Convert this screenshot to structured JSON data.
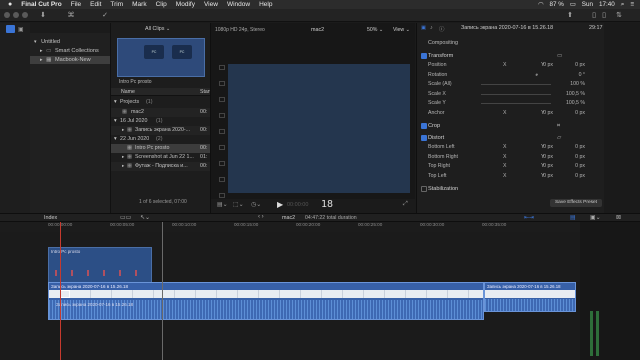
{
  "menubar": {
    "apple": "",
    "items": [
      "Final Cut Pro",
      "File",
      "Edit",
      "Trim",
      "Mark",
      "Clip",
      "Modify",
      "View",
      "Window",
      "Help"
    ],
    "battery": "87 %",
    "day": "Sun",
    "time": "17:40"
  },
  "toolbar": {
    "icons": [
      "import-icon",
      "keywords-icon",
      "checkmark-icon"
    ]
  },
  "sidebar": {
    "items": [
      {
        "label": "Untitled",
        "level": 0
      },
      {
        "label": "Smart Collections",
        "level": 1
      },
      {
        "label": "Macbook-New",
        "level": 1,
        "selected": true
      }
    ]
  },
  "browser": {
    "filter_label": "All Clips",
    "filmstrip_caption": "Intro Pc prosto",
    "columns": [
      "Name",
      "Start"
    ],
    "rows": [
      {
        "name": "Projects",
        "count": "(1)",
        "start": "",
        "type": "group"
      },
      {
        "name": "mac2",
        "count": "",
        "start": "00:",
        "type": "item"
      },
      {
        "name": "16 Jul 2020",
        "count": "(1)",
        "start": "",
        "type": "group"
      },
      {
        "name": "Запись экрана 2020-...",
        "count": "",
        "start": "00:",
        "type": "item"
      },
      {
        "name": "22 Jun 2020",
        "count": "(2)",
        "start": "",
        "type": "group"
      },
      {
        "name": "Intro Pc prosto",
        "count": "",
        "start": "00:",
        "type": "item",
        "selected": true
      },
      {
        "name": "Screenshot at Jun 22 1...",
        "count": "",
        "start": "01:",
        "type": "item"
      },
      {
        "name": "Футаж - Подписка и...",
        "count": "",
        "start": "00:",
        "type": "item"
      }
    ],
    "status": "1 of 6 selected, 07:00"
  },
  "viewer": {
    "format": "1080p HD 24p, Stereo",
    "project": "mac2",
    "zoom": "50%",
    "view_label": "View",
    "timecode": "18",
    "timecode_faint": "00:00:00"
  },
  "inspector": {
    "clip_name": "Запись экрана 2020-07-16 в 15.26.18",
    "duration": "29:17",
    "section": "Compositing",
    "rows": [
      {
        "kind": "section",
        "label": "Transform",
        "checked": true
      },
      {
        "kind": "param",
        "label": "Position",
        "xl": "X",
        "xv": "0",
        "xu": "px",
        "yl": "Y",
        "yv": "0",
        "yu": "px"
      },
      {
        "kind": "param",
        "label": "Rotation",
        "xl": "",
        "xv": "",
        "xu": "",
        "yl": "",
        "yv": "0",
        "yu": "°"
      },
      {
        "kind": "param",
        "label": "Scale (All)",
        "xl": "",
        "xv": "",
        "xu": "",
        "yl": "",
        "yv": "100",
        "yu": "%"
      },
      {
        "kind": "param",
        "label": "Scale X",
        "xl": "",
        "xv": "",
        "xu": "",
        "yl": "",
        "yv": "100,5",
        "yu": "%"
      },
      {
        "kind": "param",
        "label": "Scale Y",
        "xl": "",
        "xv": "",
        "xu": "",
        "yl": "",
        "yv": "100,5",
        "yu": "%"
      },
      {
        "kind": "param",
        "label": "Anchor",
        "xl": "X",
        "xv": "0",
        "xu": "px",
        "yl": "Y",
        "yv": "0",
        "yu": "px"
      },
      {
        "kind": "section",
        "label": "Crop",
        "checked": true
      },
      {
        "kind": "section",
        "label": "Distort",
        "checked": true
      },
      {
        "kind": "param",
        "label": "Bottom Left",
        "xl": "X",
        "xv": "0",
        "xu": "px",
        "yl": "Y",
        "yv": "0",
        "yu": "px"
      },
      {
        "kind": "param",
        "label": "Bottom Right",
        "xl": "X",
        "xv": "0",
        "xu": "px",
        "yl": "Y",
        "yv": "0",
        "yu": "px"
      },
      {
        "kind": "param",
        "label": "Top Right",
        "xl": "X",
        "xv": "0",
        "xu": "px",
        "yl": "Y",
        "yv": "0",
        "yu": "px"
      },
      {
        "kind": "param",
        "label": "Top Left",
        "xl": "X",
        "xv": "0",
        "xu": "px",
        "yl": "Y",
        "yv": "0",
        "yu": "px"
      },
      {
        "kind": "section",
        "label": "Stabilization",
        "checked": false
      }
    ],
    "save_preset": "Save Effects Preset"
  },
  "timeline": {
    "index_label": "Index",
    "project": "mac2",
    "total_duration": "04:47:22 total duration",
    "ruler": [
      "00:00:00:00",
      "00:00:05:00",
      "00:00:10:00",
      "00:00:15:00",
      "00:00:20:00",
      "00:00:25:00",
      "00:00:30:00",
      "00:00:35:00"
    ],
    "title_clip": "Intro Pc prosto",
    "primary_clip": "Запись экрана 2020-07-16 в 15.26.18",
    "secondary_clip": "Запись экрана 2020-07-16 в 15.26.18",
    "audio_clip": "Запись экрана 2020-07-16 в 15.26.18"
  },
  "colors": {
    "accent": "#3a74d6",
    "title_clip": "#2c4f86",
    "primary_clip": "#3760a8",
    "playhead": "#c53a2e",
    "audio_green": "#3b9a4a"
  }
}
